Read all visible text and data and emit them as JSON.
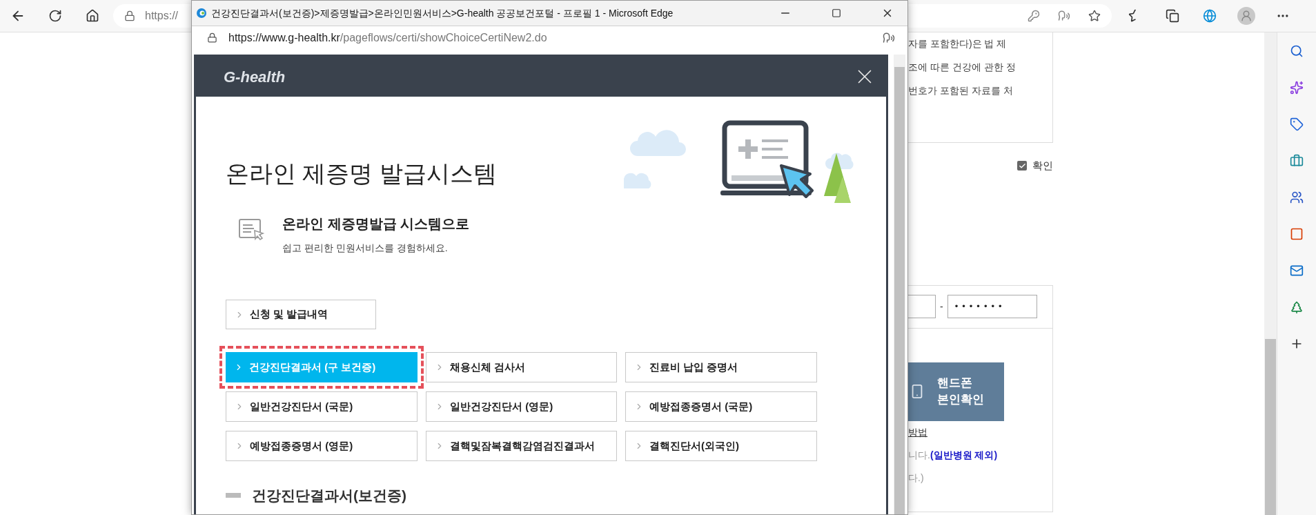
{
  "browser": {
    "address_prefix": "https://"
  },
  "page": {
    "notice_lines": [
      "자를 포함한다)은 법 제",
      "조에 따른 건강에 관한 정",
      "번호가 포함된 자료를 처"
    ],
    "agree": {
      "label": "확인",
      "checked": true
    },
    "ssn_back": "•••••••",
    "ssn_dash": "-",
    "phone_button": [
      "핸드폰",
      "본인확인"
    ],
    "method_link": "방법",
    "note_text": "니다.",
    "note_highlight": "(일반병원 제외)",
    "note_tail": "다.)"
  },
  "popup": {
    "title": "건강진단결과서(보건증)>제증명발급>온라인민원서비스>G-health 공공보건포털 - 프로필 1 - Microsoft Edge",
    "url_host": "https://www.g-health.kr",
    "url_path": "/pageflows/certi/showChoiceCertiNew2.do",
    "logo": "G-health",
    "heading": "온라인 제증명 발급시스템",
    "intro_title": "온라인 제증명발급 시스템으로",
    "intro_text": "쉽고 편리한 민원서비스를 경험하세요.",
    "history_button": "신청 및 발급내역",
    "certificates": [
      {
        "label": "건강진단결과서 (구 보건증)",
        "selected": true
      },
      {
        "label": "채용신체 검사서",
        "selected": false
      },
      {
        "label": "진료비 납입 증명서",
        "selected": false
      },
      {
        "label": "일반건강진단서 (국문)",
        "selected": false
      },
      {
        "label": "일반건강진단서 (영문)",
        "selected": false
      },
      {
        "label": "예방접종증명서 (국문)",
        "selected": false
      },
      {
        "label": "예방접종증명서 (영문)",
        "selected": false
      },
      {
        "label": "결핵및잠복결핵감염검진결과서",
        "selected": false
      },
      {
        "label": "결핵진단서(외국인)",
        "selected": false
      }
    ],
    "section_title": "건강진단결과서(보건증)"
  }
}
